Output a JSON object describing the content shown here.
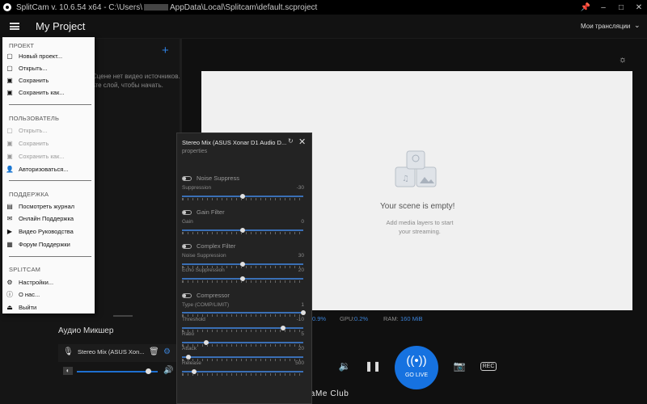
{
  "titlebar": {
    "title": "SplitCam v. 10.6.54 x64 - C:\\Users\\",
    "path_rest": "AppData\\Local\\Splitcam\\default.scproject",
    "pin_icon": "pin-icon",
    "minimize": "–",
    "maximize": "□",
    "close": "✕"
  },
  "header": {
    "project_title": "My Project",
    "broadcasts_label": "Мои трансляции"
  },
  "left_panel": {
    "scene_hint_1": "Сцене нет видео источников.",
    "scene_hint_2": "ьте слой, чтобы начать.",
    "add_icon": "+"
  },
  "menu": {
    "sections": [
      {
        "title": "ПРОЕКТ"
      },
      {
        "title": "ПОЛЬЗОВАТЕЛЬ"
      },
      {
        "title": "ПОДДЕРЖКА"
      },
      {
        "title": "SPLITCAM"
      }
    ],
    "items": [
      {
        "label": "Новый проект...",
        "icon": "new-file-icon",
        "disabled": false
      },
      {
        "label": "Открыть...",
        "icon": "open-file-icon",
        "disabled": false
      },
      {
        "label": "Сохранить",
        "icon": "save-icon",
        "disabled": false
      },
      {
        "label": "Сохранить как...",
        "icon": "save-as-icon",
        "disabled": false
      },
      {
        "label": "Открыть...",
        "icon": "open-file-icon",
        "disabled": true
      },
      {
        "label": "Сохранить",
        "icon": "save-icon",
        "disabled": true
      },
      {
        "label": "Сохранить как...",
        "icon": "save-as-icon",
        "disabled": true
      },
      {
        "label": "Авторизоваться...",
        "icon": "user-icon",
        "disabled": false
      },
      {
        "label": "Посмотреть журнал",
        "icon": "log-icon",
        "disabled": false
      },
      {
        "label": "Онлайн Поддержка",
        "icon": "chat-icon",
        "disabled": false
      },
      {
        "label": "Видео Руководства",
        "icon": "video-guide-icon",
        "disabled": false
      },
      {
        "label": "Форум Поддержки",
        "icon": "forum-icon",
        "disabled": false
      },
      {
        "label": "Настройки...",
        "icon": "gear-icon",
        "disabled": false
      },
      {
        "label": "О нас...",
        "icon": "info-icon",
        "disabled": false
      },
      {
        "label": "Выйти",
        "icon": "exit-icon",
        "disabled": false
      }
    ]
  },
  "mixer": {
    "title": "Аудио Микшер",
    "track_name": "Stereo Mix (ASUS Xon...",
    "volume_level": 0.88
  },
  "preview": {
    "empty_title": "Your scene is empty!",
    "empty_sub": "Add media layers to start your streaming."
  },
  "stats": {
    "cpu": "0.9%",
    "gpu_label": "GPU:",
    "gpu": "0.2%",
    "ram_label": "RAM:",
    "ram": "160 MiB"
  },
  "controls": {
    "go_live": "GO LIVE"
  },
  "watermark": "NaNaMe Club",
  "dialog": {
    "title": "Stereo Mix (ASUS Xonar D1 Audio D...",
    "subtitle": "properties",
    "filters": [
      {
        "name": "Noise Suppress",
        "params": [
          {
            "label": "Suppression",
            "value": "-30",
            "level": 0.5
          }
        ]
      },
      {
        "name": "Gain Filter",
        "params": [
          {
            "label": "Gain",
            "value": "0",
            "level": 0.5
          }
        ]
      },
      {
        "name": "Complex Filter",
        "params": [
          {
            "label": "Noise Suppression",
            "value": "30",
            "level": 0.5
          },
          {
            "label": "Echo Suppression",
            "value": "20",
            "level": 0.5
          }
        ]
      },
      {
        "name": "Compressor",
        "params": [
          {
            "label": "Type (COMP/LIMIT)",
            "value": "1",
            "level": 1.0
          },
          {
            "label": "Threshold",
            "value": "-10",
            "level": 0.83
          },
          {
            "label": "Ratio",
            "value": "5",
            "level": 0.2
          },
          {
            "label": "Attack",
            "value": "20",
            "level": 0.05
          },
          {
            "label": "Release",
            "value": "500",
            "level": 0.1
          }
        ]
      }
    ]
  }
}
